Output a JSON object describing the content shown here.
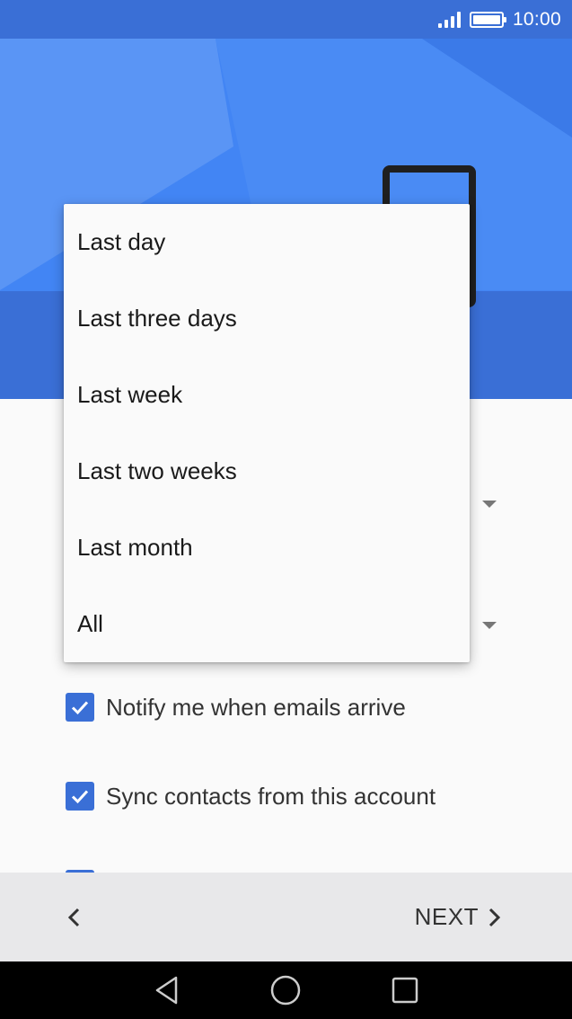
{
  "status_bar": {
    "time": "10:00",
    "icons": [
      "signal-icon",
      "battery-icon"
    ]
  },
  "settings": {
    "checkboxes": [
      {
        "label": "Notify me when emails arrive",
        "checked": true
      },
      {
        "label": "Sync contacts from this account",
        "checked": true
      }
    ]
  },
  "sync_period_menu": {
    "options": [
      "Last day",
      "Last three days",
      "Last week",
      "Last two weeks",
      "Last month",
      "All"
    ]
  },
  "nav_bar": {
    "next_label": "NEXT",
    "icons": [
      "chevron-left-icon",
      "chevron-right-icon"
    ]
  },
  "system_nav": {
    "icons": [
      "back-triangle-icon",
      "home-circle-icon",
      "recents-square-icon"
    ]
  },
  "colors": {
    "status_bar": "#3a6fd6",
    "header": "#4285f4",
    "header_band": "#3a6fd6",
    "checkbox": "#3a6fd6",
    "nav_bar": "#e8e8ea",
    "menu_background": "#fafafa"
  }
}
